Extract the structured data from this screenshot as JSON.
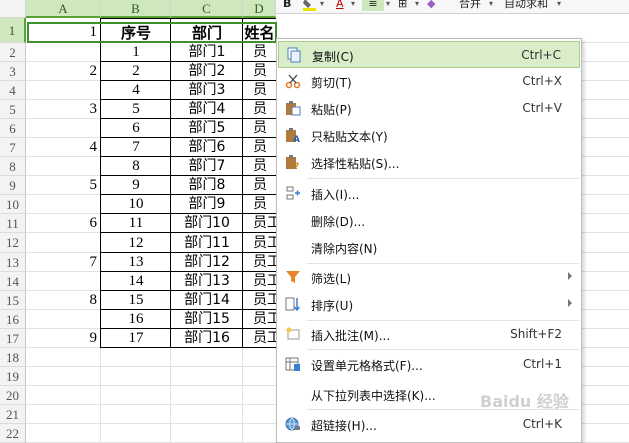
{
  "columns": [
    "A",
    "B",
    "C",
    "D"
  ],
  "row_numbers": [
    "1",
    "2",
    "3",
    "4",
    "5",
    "6",
    "7",
    "8",
    "9",
    "10",
    "11",
    "12",
    "13",
    "14",
    "15",
    "16",
    "17",
    "18",
    "19",
    "20",
    "21",
    "22"
  ],
  "cells": {
    "a1": "1",
    "b1": "序号",
    "c1": "部门",
    "d1": "姓名",
    "a3": "2",
    "a5": "3",
    "a7": "4",
    "a9": "5",
    "a11": "6",
    "a13": "7",
    "a15": "8",
    "a17": "9",
    "serials": [
      "1",
      "2",
      "4",
      "5",
      "6",
      "7",
      "8",
      "9",
      "10",
      "11",
      "12",
      "13",
      "14",
      "15",
      "16",
      "17"
    ],
    "departments": [
      "部门1",
      "部门2",
      "部门3",
      "部门4",
      "部门5",
      "部门6",
      "部门7",
      "部门8",
      "部门9",
      "部门10",
      "部门11",
      "部门12",
      "部门13",
      "部门14",
      "部门15",
      "部门16"
    ],
    "names": [
      "员",
      "员",
      "员",
      "员",
      "员",
      "员",
      "员",
      "员",
      "员",
      "员工",
      "员工",
      "员工",
      "员工",
      "员工",
      "员工",
      "员工"
    ]
  },
  "ribbon": {
    "bold": "B",
    "font_color": "A",
    "merge": "合并",
    "autosum": "自动求和"
  },
  "context_menu": {
    "items": [
      {
        "label": "复制(C)",
        "shortcut": "Ctrl+C",
        "icon": "copy-icon"
      },
      {
        "label": "剪切(T)",
        "shortcut": "Ctrl+X",
        "icon": "cut-icon"
      },
      {
        "label": "粘贴(P)",
        "shortcut": "Ctrl+V",
        "icon": "paste-icon"
      },
      {
        "label": "只粘贴文本(Y)",
        "shortcut": "",
        "icon": "paste-text-icon"
      },
      {
        "label": "选择性粘贴(S)...",
        "shortcut": "",
        "icon": "paste-special-icon"
      },
      {
        "label": "插入(I)...",
        "shortcut": "",
        "icon": "insert-icon"
      },
      {
        "label": "删除(D)...",
        "shortcut": "",
        "icon": ""
      },
      {
        "label": "清除内容(N)",
        "shortcut": "",
        "icon": ""
      },
      {
        "label": "筛选(L)",
        "shortcut": "",
        "icon": "filter-icon"
      },
      {
        "label": "排序(U)",
        "shortcut": "",
        "icon": "sort-icon"
      },
      {
        "label": "插入批注(M)...",
        "shortcut": "Shift+F2",
        "icon": "comment-icon"
      },
      {
        "label": "设置单元格格式(F)...",
        "shortcut": "Ctrl+1",
        "icon": "format-cells-icon"
      },
      {
        "label": "从下拉列表中选择(K)...",
        "shortcut": "",
        "icon": ""
      },
      {
        "label": "超链接(H)...",
        "shortcut": "Ctrl+K",
        "icon": "hyperlink-icon"
      }
    ]
  },
  "watermark": "Baidu 经验",
  "colors": {
    "selection_green": "#3f8f2c",
    "menu_highlight": "#d9edc9",
    "header_bg": "#f3f3f3"
  }
}
